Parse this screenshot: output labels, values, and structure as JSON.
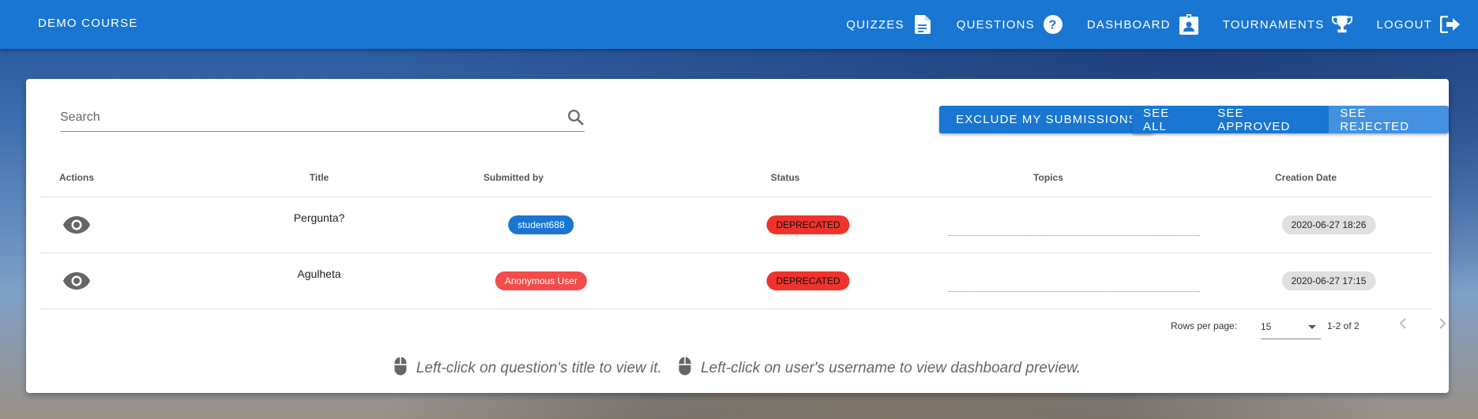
{
  "appbar": {
    "brand": "DEMO COURSE",
    "nav": [
      {
        "label": "QUIZZES",
        "icon": "file-document-icon"
      },
      {
        "label": "QUESTIONS",
        "icon": "help-circle-icon"
      },
      {
        "label": "DASHBOARD",
        "icon": "account-box-icon"
      },
      {
        "label": "TOURNAMENTS",
        "icon": "trophy-icon"
      },
      {
        "label": "LOGOUT",
        "icon": "logout-icon"
      }
    ]
  },
  "toolbar": {
    "search_placeholder": "Search",
    "exclude_label": "EXCLUDE MY SUBMISSIONS",
    "filters": [
      "SEE ALL",
      "SEE APPROVED",
      "SEE REJECTED"
    ],
    "active_filter": "SEE REJECTED"
  },
  "table": {
    "headers": [
      "Actions",
      "Title",
      "Submitted by",
      "Status",
      "Topics",
      "Creation Date"
    ],
    "rows": [
      {
        "title": "Pergunta?",
        "submitted_by": "student688",
        "anonymous": false,
        "status": "DEPRECATED",
        "date": "2020-06-27 18:26"
      },
      {
        "title": "Agulheta",
        "submitted_by": "Anonymous User",
        "anonymous": true,
        "status": "DEPRECATED",
        "date": "2020-06-27 17:15"
      }
    ],
    "footer": {
      "rows_per_page_label": "Rows per page:",
      "rows_per_page": "15",
      "range": "1-2 of 2"
    }
  },
  "hints": [
    "Left-click on question's title to view it.",
    "Left-click on user's username to view dashboard preview."
  ],
  "colors": {
    "primary": "#1976d2",
    "anonymous_chip": "#f44b4b",
    "status_chip": "#f0332a",
    "date_chip": "#e0e0e0"
  }
}
